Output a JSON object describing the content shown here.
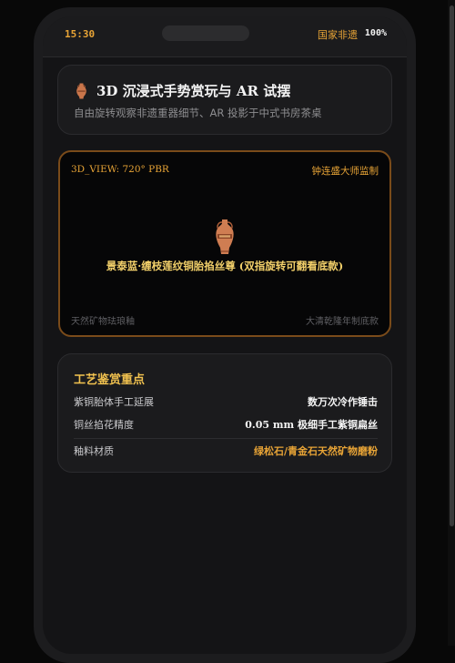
{
  "status_bar": {
    "time": "15:30",
    "carrier": "国家非遗",
    "battery": "100%"
  },
  "header": {
    "icon": "amphora-icon",
    "title": "3D 沉浸式手势赏玩与 AR 试摆",
    "subtitle": "自由旋转观察非遗重器细节、AR 投影于中式书房茶桌"
  },
  "viewer": {
    "mode_label": "3D_VIEW: 720° PBR",
    "supervisor": "钟连盛大师监制",
    "object_icon": "amphora-icon",
    "object_name": "景泰蓝·缠枝莲纹铜胎掐丝尊 (双指旋转可翻看底款)",
    "material_note": "天然矿物珐琅釉",
    "era_note": "大清乾隆年制底款"
  },
  "craft_points": {
    "title": "工艺鉴赏重点",
    "rows": [
      {
        "label": "紫铜胎体手工延展",
        "value": "数万次冷作锤击"
      },
      {
        "label": "铜丝掐花精度",
        "value": "0.05 mm 极细手工紫铜扁丝"
      },
      {
        "label": "釉料材质",
        "value": "绿松石/青金石天然矿物磨粉"
      }
    ]
  },
  "colors": {
    "accent": "#e8a436",
    "gold_text": "#f2d06a",
    "viewer_border": "#7a4b1a",
    "background": "#141416"
  }
}
